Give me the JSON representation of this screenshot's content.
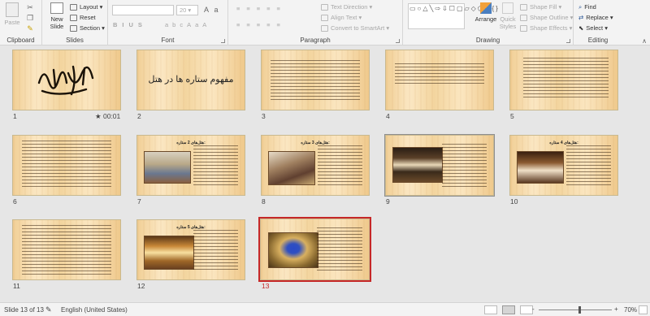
{
  "ribbon": {
    "clipboard": {
      "label": "Clipboard",
      "paste": "Paste"
    },
    "slides": {
      "label": "Slides",
      "new_slide": "New",
      "new_slide2": "Slide",
      "layout": "Layout",
      "reset": "Reset",
      "section": "Section"
    },
    "font": {
      "label": "Font",
      "size": "20"
    },
    "paragraph": {
      "label": "Paragraph",
      "text_direction": "Text Direction",
      "align_text": "Align Text",
      "convert_smartart": "Convert to SmartArt"
    },
    "drawing": {
      "label": "Drawing",
      "arrange": "Arrange",
      "quick_styles": "Quick",
      "quick_styles2": "Styles",
      "shape_fill": "Shape Fill",
      "shape_outline": "Shape Outline",
      "shape_effects": "Shape Effects"
    },
    "editing": {
      "label": "Editing",
      "find": "Find",
      "replace": "Replace",
      "select": "Select"
    }
  },
  "slides": [
    {
      "num": "1",
      "timing": "00:01"
    },
    {
      "num": "2",
      "title": "مفهوم ستاره ها در هتل"
    },
    {
      "num": "3"
    },
    {
      "num": "4"
    },
    {
      "num": "5"
    },
    {
      "num": "6"
    },
    {
      "num": "7",
      "heading": "هتل‌های 2 ستاره:"
    },
    {
      "num": "8",
      "heading": "هتل‌های 3 ستاره:"
    },
    {
      "num": "9"
    },
    {
      "num": "10",
      "heading": "هتل‌های 4 ستاره:"
    },
    {
      "num": "11"
    },
    {
      "num": "12",
      "heading": "هتل‌های 5 ستاره:"
    },
    {
      "num": "13"
    }
  ],
  "status": {
    "slide_info": "Slide 13 of 13",
    "language": "English (United States)",
    "zoom": "70%",
    "zoom_minus": "-",
    "zoom_plus": "+"
  },
  "colors": {
    "accent_selected": "#c62828",
    "slide_bg": "#f6dcab"
  }
}
